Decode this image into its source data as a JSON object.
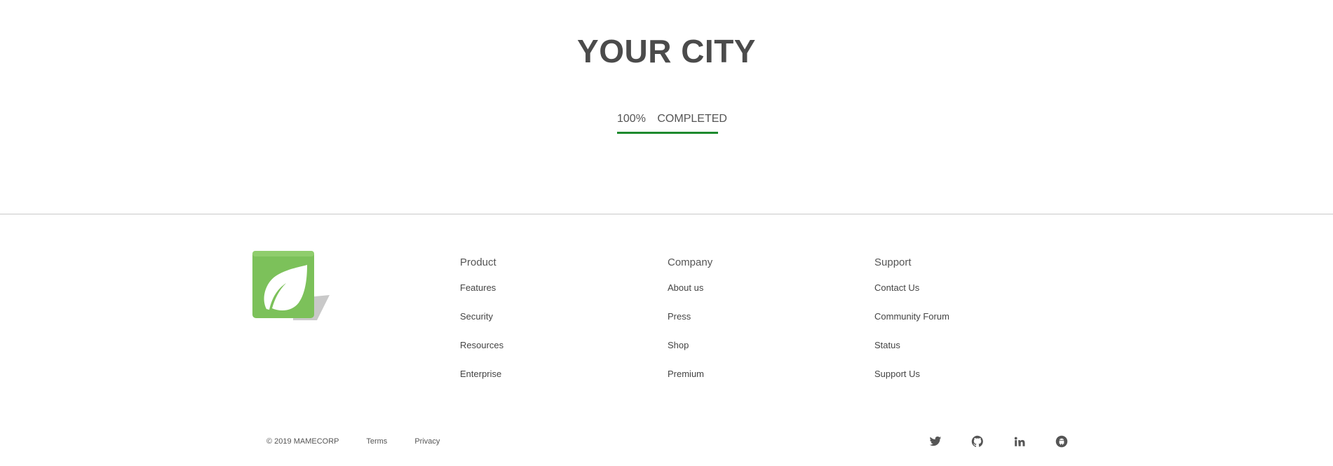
{
  "hero": {
    "title": "YOUR CITY",
    "progress": {
      "percent_label": "100%",
      "status_label": "COMPLETED",
      "value": 1.0,
      "color": "#1e8a2e"
    }
  },
  "footer": {
    "logo_icon": "leaf-logo-icon",
    "columns": [
      {
        "heading": "Product",
        "links": [
          "Features",
          "Security",
          "Resources",
          "Enterprise"
        ]
      },
      {
        "heading": "Company",
        "links": [
          "About us",
          "Press",
          "Shop",
          "Premium"
        ]
      },
      {
        "heading": "Support",
        "links": [
          "Contact Us",
          "Community Forum",
          "Status",
          "Support Us"
        ]
      }
    ],
    "copyright": "© 2019 MAMECORP",
    "terms": "Terms",
    "privacy": "Privacy",
    "socials": [
      "twitter-icon",
      "github-icon",
      "linkedin-icon",
      "android-icon"
    ]
  }
}
